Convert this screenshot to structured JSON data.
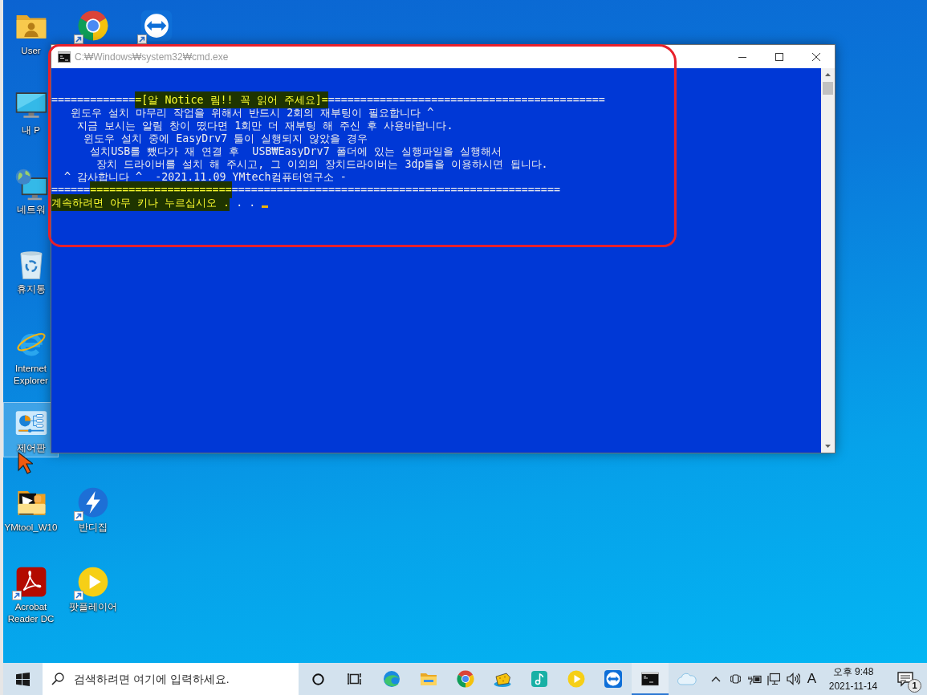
{
  "window": {
    "title": "C:₩Windows₩system32₩cmd.exe",
    "console": {
      "lines": [
        {
          "segments": [
            {
              "text": "=============",
              "highlighted": false
            },
            {
              "text": "=[알 Notice 림!! 꼭 읽어 주세요]=",
              "highlighted": true
            },
            {
              "text": "===========================================",
              "highlighted": false
            }
          ]
        },
        {
          "segments": [
            {
              "text": "   윈도우 설치 마무리 작업을 위해서 반드시 2회의 재부팅이 필요합니다 ^",
              "highlighted": false
            }
          ]
        },
        {
          "segments": [
            {
              "text": "    지금 보시는 알림 창이 떴다면 1회만 더 재부팅 해 주신 후 사용바랍니다.",
              "highlighted": false
            }
          ]
        },
        {
          "segments": [
            {
              "text": "     윈도우 설치 중에 EasyDrv7 툴이 실행되지 않았을 경우",
              "highlighted": false
            }
          ]
        },
        {
          "segments": [
            {
              "text": "      설치USB를 뺐다가 재 연결 후  USB₩EasyDrv7 폴더에 있는 실행파일을 실행해서",
              "highlighted": false
            }
          ]
        },
        {
          "segments": [
            {
              "text": "       장치 드라이버를 설치 해 주시고, 그 이외의 장치드라이버는 3dp툴을 이용하시면 됩니다.",
              "highlighted": false
            }
          ]
        },
        {
          "segments": [
            {
              "text": "  ^ 감사합니다 ^  -2021.11.09 YMtech컴퓨터연구소 -",
              "highlighted": false
            }
          ]
        },
        {
          "segments": [
            {
              "text": "======",
              "highlighted": false
            },
            {
              "text": "======================",
              "highlighted": true
            },
            {
              "text": "===================================================",
              "highlighted": false
            }
          ]
        },
        {
          "segments": [
            {
              "text": "계속하려면 아무 키나 누르십시오 .",
              "highlighted": true
            },
            {
              "text": " . .",
              "highlighted": false
            }
          ]
        }
      ],
      "cursor": true
    }
  },
  "desktop": {
    "columns": [
      {
        "icons": [
          {
            "kind": "user_folder",
            "label": "User",
            "shortcut": false,
            "selected": false
          },
          {
            "kind": "pc",
            "label": "내 P",
            "shortcut": false,
            "selected": false
          },
          {
            "kind": "network",
            "label": "네트워",
            "shortcut": false,
            "selected": false
          },
          {
            "kind": "recycle_bin",
            "label": "휴지통",
            "shortcut": false,
            "selected": false
          },
          {
            "kind": "ie",
            "label": "Internet Explorer",
            "shortcut": false,
            "selected": false
          },
          {
            "kind": "control_panel",
            "label": "제어판",
            "shortcut": false,
            "selected": true
          },
          {
            "kind": "app_folder",
            "label": "YMtool_W10",
            "shortcut": false,
            "selected": false
          },
          {
            "kind": "acrobat",
            "label": "Acrobat Reader DC",
            "shortcut": true,
            "selected": false
          }
        ]
      },
      {
        "icons": [
          {
            "kind": "chrome",
            "shortcut": true,
            "selected": false
          },
          {
            "kind": "bandizip",
            "label": "반디집",
            "shortcut": true,
            "selected": false
          },
          {
            "kind": "potplayer",
            "label": "팟플레이어",
            "shortcut": true,
            "selected": false
          }
        ]
      },
      {
        "icons": [
          {
            "kind": "teamviewer",
            "shortcut": true,
            "selected": false
          }
        ]
      }
    ]
  },
  "taskbar": {
    "search": {
      "placeholder": "검색하려면 여기에 입력하세요."
    },
    "apps": [
      {
        "kind": "edge",
        "active": false
      },
      {
        "kind": "explorer",
        "active": false
      },
      {
        "kind": "chrome",
        "active": false
      },
      {
        "kind": "sponge",
        "active": false
      },
      {
        "kind": "music",
        "active": false
      },
      {
        "kind": "potplayer",
        "active": false
      },
      {
        "kind": "teamviewer",
        "active": false
      },
      {
        "kind": "cmd",
        "active": true
      }
    ],
    "input_indicator": "A",
    "clock": {
      "time": "오후 9:48",
      "date": "2021-11-14"
    },
    "notification_count": "1"
  }
}
